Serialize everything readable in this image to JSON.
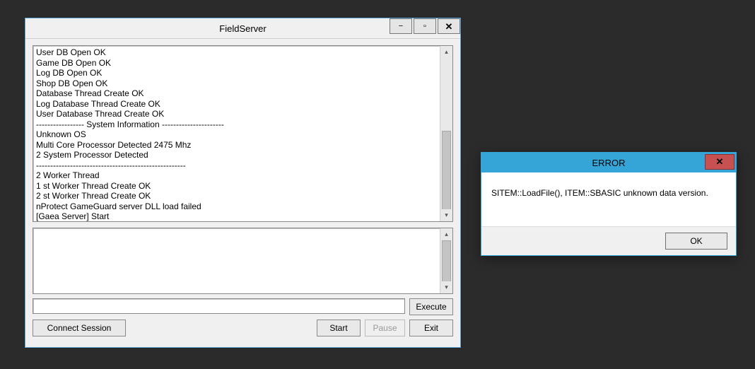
{
  "main": {
    "title": "FieldServer",
    "controls": {
      "minimize": "—",
      "maximize": "□",
      "close": "✕"
    },
    "log_lines": [
      "User DB Open OK",
      "Game DB Open OK",
      "Log DB Open OK",
      "Shop DB Open OK",
      "Database Thread Create OK",
      "Log Database Thread Create OK",
      "User Database Thread Create OK",
      "----------------- System Information ----------------------",
      "Unknown OS",
      "Multi Core Processor Detected 2475 Mhz",
      "2 System Processor Detected",
      "-----------------------------------------------------",
      "2 Worker Thread",
      "1 st Worker Thread Create OK",
      "2 st Worker Thread Create OK",
      "nProtect GameGuard server DLL load failed",
      "[Gaea Server] Start"
    ],
    "command_value": "",
    "buttons": {
      "execute": "Execute",
      "connect": "Connect Session",
      "start": "Start",
      "pause": "Pause",
      "exit": "Exit"
    }
  },
  "error": {
    "title": "ERROR",
    "close": "✕",
    "message": "SITEM::LoadFile(), ITEM::SBASIC unknown data version.",
    "ok": "OK"
  }
}
